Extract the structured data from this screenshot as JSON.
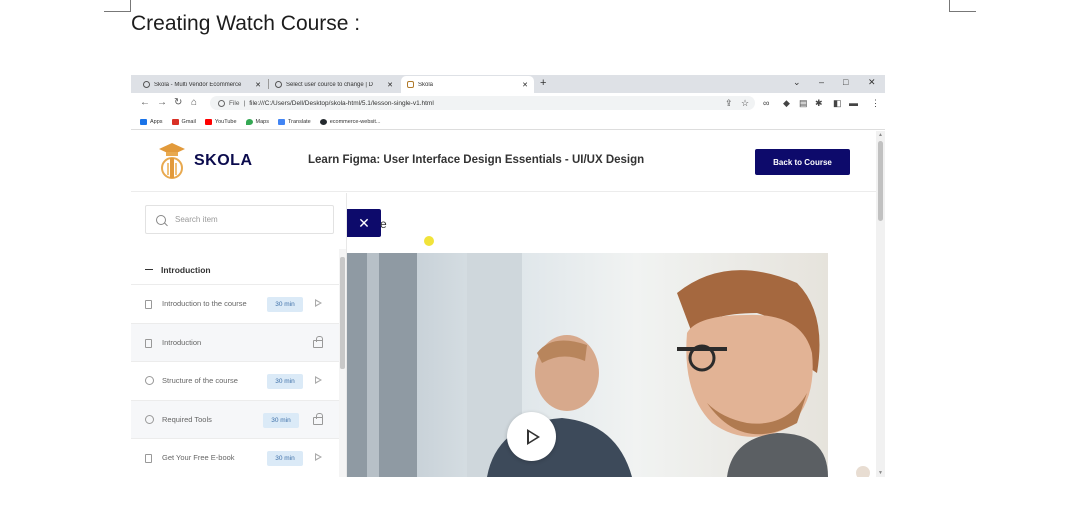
{
  "document": {
    "heading": "Creating Watch Course :"
  },
  "browser": {
    "tabs": [
      {
        "title": "Skola - Multi Vendor Ecommerce",
        "active": false
      },
      {
        "title": "Select user cource to change | D",
        "active": false
      },
      {
        "title": "Skola",
        "active": true
      }
    ],
    "address": {
      "prefix": "File",
      "url": "file:///C:/Users/Dell/Desktop/skola-html/5.1/lesson-single-v1.html"
    },
    "bookmarks": [
      {
        "label": "Apps",
        "color": "#1a73e8"
      },
      {
        "label": "Gmail",
        "color": "#d93025"
      },
      {
        "label": "YouTube",
        "color": "#ff0000"
      },
      {
        "label": "Maps",
        "color": "#34a853"
      },
      {
        "label": "Translate",
        "color": "#4285f4"
      },
      {
        "label": "ecommerce-websit...",
        "color": "#24292e"
      }
    ]
  },
  "site": {
    "logo_text": "SKOLA",
    "course_title": "Learn Figma: User Interface Design Essentials - UI/UX Design",
    "back_button": "Back to Course",
    "search_placeholder": "Search item",
    "section_title": "Introduction",
    "close_glyph": "✕",
    "peek_letter": "e",
    "lessons": [
      {
        "label": "Introduction to the course",
        "badge": "30 min",
        "icon": "document-icon",
        "action": "play"
      },
      {
        "label": "Introduction",
        "badge": "",
        "icon": "document-icon",
        "action": "lock"
      },
      {
        "label": "Structure of the course",
        "badge": "30 min",
        "icon": "clock-icon",
        "action": "play"
      },
      {
        "label": "Required Tools",
        "badge": "30 min",
        "icon": "clock-icon",
        "action": "lock"
      },
      {
        "label": "Get Your Free E-book",
        "badge": "30 min",
        "icon": "document-icon",
        "action": "play"
      }
    ]
  },
  "colors": {
    "brand_navy": "#0d0a6b",
    "badge_bg": "#dbeaf7",
    "badge_text": "#3d6fa8"
  }
}
